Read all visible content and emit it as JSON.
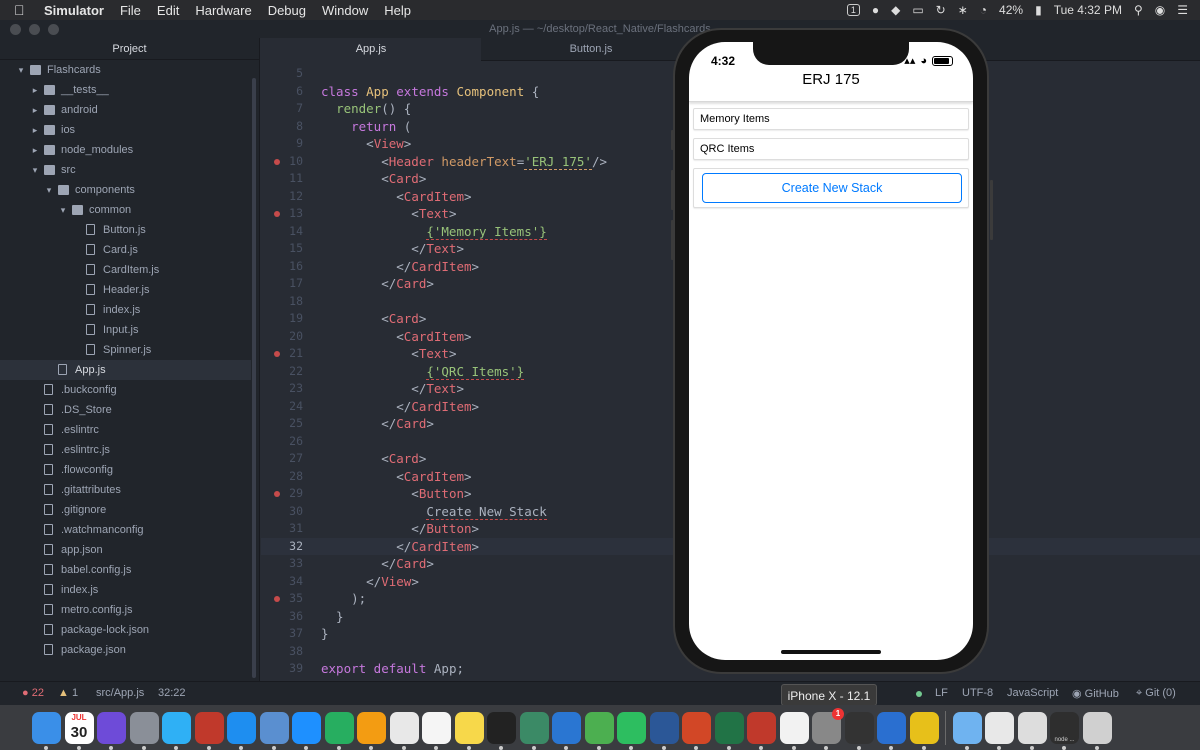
{
  "menubar": {
    "app_name": "Simulator",
    "items": [
      "File",
      "Edit",
      "Hardware",
      "Debug",
      "Window",
      "Help"
    ],
    "badge": "1",
    "battery": "42%",
    "clock": "Tue 4:32 PM"
  },
  "window": {
    "title": "App.js — ~/desktop/React_Native/Flashcards"
  },
  "tree": {
    "header": "Project",
    "items": [
      {
        "label": "Flashcards",
        "type": "folder",
        "depth": 0,
        "expanded": true
      },
      {
        "label": "__tests__",
        "type": "folder",
        "depth": 1,
        "expanded": false
      },
      {
        "label": "android",
        "type": "folder",
        "depth": 1,
        "expanded": false
      },
      {
        "label": "ios",
        "type": "folder",
        "depth": 1,
        "expanded": false
      },
      {
        "label": "node_modules",
        "type": "folder",
        "depth": 1,
        "expanded": false
      },
      {
        "label": "src",
        "type": "folder",
        "depth": 1,
        "expanded": true
      },
      {
        "label": "components",
        "type": "folder",
        "depth": 2,
        "expanded": true
      },
      {
        "label": "common",
        "type": "folder",
        "depth": 3,
        "expanded": true
      },
      {
        "label": "Button.js",
        "type": "file",
        "depth": 4
      },
      {
        "label": "Card.js",
        "type": "file",
        "depth": 4
      },
      {
        "label": "CardItem.js",
        "type": "file",
        "depth": 4
      },
      {
        "label": "Header.js",
        "type": "file",
        "depth": 4
      },
      {
        "label": "index.js",
        "type": "file",
        "depth": 4
      },
      {
        "label": "Input.js",
        "type": "file",
        "depth": 4
      },
      {
        "label": "Spinner.js",
        "type": "file",
        "depth": 4
      },
      {
        "label": "App.js",
        "type": "file",
        "depth": 2,
        "selected": true
      },
      {
        "label": ".buckconfig",
        "type": "file",
        "depth": 1
      },
      {
        "label": ".DS_Store",
        "type": "file",
        "depth": 1
      },
      {
        "label": ".eslintrc",
        "type": "file",
        "depth": 1
      },
      {
        "label": ".eslintrc.js",
        "type": "file",
        "depth": 1
      },
      {
        "label": ".flowconfig",
        "type": "file",
        "depth": 1
      },
      {
        "label": ".gitattributes",
        "type": "file",
        "depth": 1
      },
      {
        "label": ".gitignore",
        "type": "file",
        "depth": 1
      },
      {
        "label": ".watchmanconfig",
        "type": "file",
        "depth": 1
      },
      {
        "label": "app.json",
        "type": "file",
        "depth": 1
      },
      {
        "label": "babel.config.js",
        "type": "file",
        "depth": 1
      },
      {
        "label": "index.js",
        "type": "file",
        "depth": 1
      },
      {
        "label": "metro.config.js",
        "type": "file",
        "depth": 1
      },
      {
        "label": "package-lock.json",
        "type": "file",
        "depth": 1
      },
      {
        "label": "package.json",
        "type": "file",
        "depth": 1
      }
    ]
  },
  "tabs": [
    {
      "label": "App.js",
      "active": true
    },
    {
      "label": "Button.js",
      "active": false
    }
  ],
  "editor": {
    "cursor_line": 32,
    "lines": [
      {
        "n": 5,
        "err": false,
        "tokens": []
      },
      {
        "n": 6,
        "err": false,
        "tokens": [
          [
            "kw",
            "class "
          ],
          [
            "cls",
            "App "
          ],
          [
            "kw",
            "extends "
          ],
          [
            "cls",
            "Component "
          ],
          [
            "pun",
            "{"
          ]
        ]
      },
      {
        "n": 7,
        "err": false,
        "tokens": [
          [
            "pun",
            "  "
          ],
          [
            "attr2",
            "render"
          ],
          [
            "pun",
            "() {"
          ]
        ]
      },
      {
        "n": 8,
        "err": false,
        "tokens": [
          [
            "pun",
            "    "
          ],
          [
            "kw",
            "return "
          ],
          [
            "pun",
            "("
          ]
        ]
      },
      {
        "n": 9,
        "err": false,
        "tokens": [
          [
            "pun",
            "      <"
          ],
          [
            "tag",
            "View"
          ],
          [
            "pun",
            ">"
          ]
        ]
      },
      {
        "n": 10,
        "err": true,
        "tokens": [
          [
            "pun",
            "        <"
          ],
          [
            "tag",
            "Header "
          ],
          [
            "attr",
            "headerText"
          ],
          [
            "pun",
            "="
          ],
          [
            "strY",
            "'ERJ 175'"
          ],
          [
            "pun",
            "/>"
          ]
        ]
      },
      {
        "n": 11,
        "err": false,
        "tokens": [
          [
            "pun",
            "        <"
          ],
          [
            "tag",
            "Card"
          ],
          [
            "pun",
            ">"
          ]
        ]
      },
      {
        "n": 12,
        "err": false,
        "tokens": [
          [
            "pun",
            "          <"
          ],
          [
            "tag",
            "CardItem"
          ],
          [
            "pun",
            ">"
          ]
        ]
      },
      {
        "n": 13,
        "err": true,
        "tokens": [
          [
            "pun",
            "            <"
          ],
          [
            "tag",
            "Text"
          ],
          [
            "pun",
            ">"
          ]
        ]
      },
      {
        "n": 14,
        "err": false,
        "tokens": [
          [
            "pun",
            "              "
          ],
          [
            "strU",
            "{'Memory Items'}"
          ]
        ]
      },
      {
        "n": 15,
        "err": false,
        "tokens": [
          [
            "pun",
            "            </"
          ],
          [
            "tag",
            "Text"
          ],
          [
            "pun",
            ">"
          ]
        ]
      },
      {
        "n": 16,
        "err": false,
        "tokens": [
          [
            "pun",
            "          </"
          ],
          [
            "tag",
            "CardItem"
          ],
          [
            "pun",
            ">"
          ]
        ]
      },
      {
        "n": 17,
        "err": false,
        "tokens": [
          [
            "pun",
            "        </"
          ],
          [
            "tag",
            "Card"
          ],
          [
            "pun",
            ">"
          ]
        ]
      },
      {
        "n": 18,
        "err": false,
        "tokens": []
      },
      {
        "n": 19,
        "err": false,
        "tokens": [
          [
            "pun",
            "        <"
          ],
          [
            "tag",
            "Card"
          ],
          [
            "pun",
            ">"
          ]
        ]
      },
      {
        "n": 20,
        "err": false,
        "tokens": [
          [
            "pun",
            "          <"
          ],
          [
            "tag",
            "CardItem"
          ],
          [
            "pun",
            ">"
          ]
        ]
      },
      {
        "n": 21,
        "err": true,
        "tokens": [
          [
            "pun",
            "            <"
          ],
          [
            "tag",
            "Text"
          ],
          [
            "pun",
            ">"
          ]
        ]
      },
      {
        "n": 22,
        "err": false,
        "tokens": [
          [
            "pun",
            "              "
          ],
          [
            "strU",
            "{'QRC Items'}"
          ]
        ]
      },
      {
        "n": 23,
        "err": false,
        "tokens": [
          [
            "pun",
            "            </"
          ],
          [
            "tag",
            "Text"
          ],
          [
            "pun",
            ">"
          ]
        ]
      },
      {
        "n": 24,
        "err": false,
        "tokens": [
          [
            "pun",
            "          </"
          ],
          [
            "tag",
            "CardItem"
          ],
          [
            "pun",
            ">"
          ]
        ]
      },
      {
        "n": 25,
        "err": false,
        "tokens": [
          [
            "pun",
            "        </"
          ],
          [
            "tag",
            "Card"
          ],
          [
            "pun",
            ">"
          ]
        ]
      },
      {
        "n": 26,
        "err": false,
        "tokens": []
      },
      {
        "n": 27,
        "err": false,
        "tokens": [
          [
            "pun",
            "        <"
          ],
          [
            "tag",
            "Card"
          ],
          [
            "pun",
            ">"
          ]
        ]
      },
      {
        "n": 28,
        "err": false,
        "tokens": [
          [
            "pun",
            "          <"
          ],
          [
            "tag",
            "CardItem"
          ],
          [
            "pun",
            ">"
          ]
        ]
      },
      {
        "n": 29,
        "err": true,
        "tokens": [
          [
            "pun",
            "            <"
          ],
          [
            "tag",
            "Button"
          ],
          [
            "pun",
            ">"
          ]
        ]
      },
      {
        "n": 30,
        "err": false,
        "tokens": [
          [
            "pun",
            "              "
          ],
          [
            "plainU",
            "Create New Stack"
          ]
        ]
      },
      {
        "n": 31,
        "err": false,
        "tokens": [
          [
            "pun",
            "            </"
          ],
          [
            "tag",
            "Button"
          ],
          [
            "pun",
            ">"
          ]
        ]
      },
      {
        "n": 32,
        "err": false,
        "tokens": [
          [
            "pun",
            "          </"
          ],
          [
            "tag",
            "CardItem"
          ],
          [
            "pun",
            ">"
          ]
        ]
      },
      {
        "n": 33,
        "err": false,
        "tokens": [
          [
            "pun",
            "        </"
          ],
          [
            "tag",
            "Card"
          ],
          [
            "pun",
            ">"
          ]
        ]
      },
      {
        "n": 34,
        "err": false,
        "tokens": [
          [
            "pun",
            "      </"
          ],
          [
            "tag",
            "View"
          ],
          [
            "pun",
            ">"
          ]
        ]
      },
      {
        "n": 35,
        "err": true,
        "tokens": [
          [
            "pun",
            "    );"
          ]
        ]
      },
      {
        "n": 36,
        "err": false,
        "tokens": [
          [
            "pun",
            "  }"
          ]
        ]
      },
      {
        "n": 37,
        "err": false,
        "tokens": [
          [
            "pun",
            "}"
          ]
        ]
      },
      {
        "n": 38,
        "err": false,
        "tokens": []
      },
      {
        "n": 39,
        "err": false,
        "tokens": [
          [
            "kw",
            "export default "
          ],
          [
            "pun",
            "App;"
          ]
        ]
      }
    ]
  },
  "statusbar": {
    "errors": "22",
    "warnings": "1",
    "file": "src/App.js",
    "position": "32:22",
    "line_ending": "LF",
    "encoding": "UTF-8",
    "grammar": "JavaScript",
    "github": "GitHub",
    "git": "Git (0)"
  },
  "simulator": {
    "device_label": "iPhone X - 12.1",
    "time": "4:32",
    "header_text": "ERJ 175",
    "cards": [
      "Memory Items",
      "QRC Items"
    ],
    "button_label": "Create New Stack"
  },
  "dock": {
    "calendar_month": "JUL",
    "calendar_day": "30",
    "notification_badge": "1",
    "icons": [
      {
        "name": "finder-icon",
        "color": "#3a8fe8"
      },
      {
        "name": "calendar-icon",
        "color": "#ffffff"
      },
      {
        "name": "siri-icon",
        "color": "#6e4bd8"
      },
      {
        "name": "launchpad-icon",
        "color": "#8a8f98"
      },
      {
        "name": "messages-icon",
        "color": "#2fb0f5"
      },
      {
        "name": "photo-booth-icon",
        "color": "#c0392b"
      },
      {
        "name": "app-store-icon",
        "color": "#1e8ef0"
      },
      {
        "name": "preview-icon",
        "color": "#5a8fd0"
      },
      {
        "name": "safari-icon",
        "color": "#1e90ff"
      },
      {
        "name": "numbers-icon",
        "color": "#27ae60"
      },
      {
        "name": "books-icon",
        "color": "#f39c12"
      },
      {
        "name": "chrome-icon",
        "color": "#e8e8e8"
      },
      {
        "name": "music-icon",
        "color": "#f5f5f5"
      },
      {
        "name": "notes-icon",
        "color": "#f7d84a"
      },
      {
        "name": "terminal-icon",
        "color": "#222222"
      },
      {
        "name": "atom-icon",
        "color": "#3b8a66"
      },
      {
        "name": "xcode-icon",
        "color": "#2a76d2"
      },
      {
        "name": "android-studio-icon",
        "color": "#4caf50"
      },
      {
        "name": "evernote-icon",
        "color": "#2dbe60"
      },
      {
        "name": "word-icon",
        "color": "#2b5797"
      },
      {
        "name": "powerpoint-icon",
        "color": "#d24726"
      },
      {
        "name": "excel-icon",
        "color": "#217346"
      },
      {
        "name": "acrobat-icon",
        "color": "#c0392b"
      },
      {
        "name": "slack-icon",
        "color": "#f2f2f2"
      },
      {
        "name": "simulator-icon",
        "color": "#888888"
      },
      {
        "name": "console-icon",
        "color": "#333333"
      },
      {
        "name": "system-preferences-icon",
        "color": "#2a6fd0"
      },
      {
        "name": "wifi-diagnostics-icon",
        "color": "#e7c01a"
      }
    ],
    "trailing_icons": [
      {
        "name": "downloads-folder-icon",
        "color": "#6fb3f0"
      },
      {
        "name": "document-icon",
        "color": "#e8e8e8"
      },
      {
        "name": "window-preview-icon",
        "color": "#dddddd"
      },
      {
        "name": "node-window-icon",
        "color": "#2e2e2e",
        "label": "node ..."
      },
      {
        "name": "trash-icon",
        "color": "#d0d0d0"
      }
    ]
  }
}
